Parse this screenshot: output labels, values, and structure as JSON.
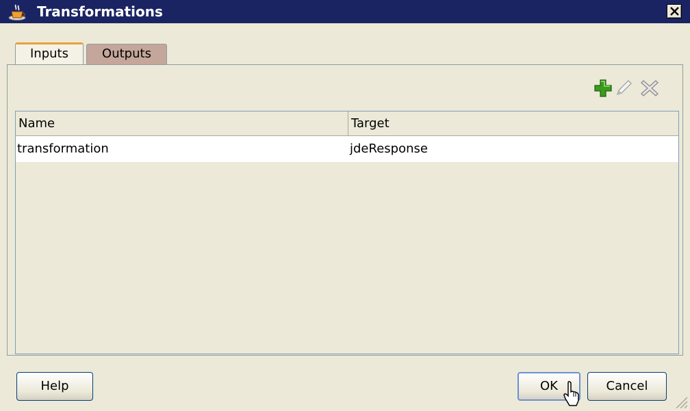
{
  "window": {
    "title": "Transformations",
    "close_icon": "close-icon",
    "app_icon": "coffee-cup-icon"
  },
  "tabs": [
    {
      "label": "Inputs",
      "selected": true
    },
    {
      "label": "Outputs",
      "selected": false
    }
  ],
  "toolbar": {
    "icons": [
      "add-icon",
      "edit-icon",
      "delete-icon"
    ],
    "add_color": "#3a9b1e"
  },
  "table": {
    "columns": [
      "Name",
      "Target"
    ],
    "rows": [
      {
        "name": "transformation",
        "target": "jdeResponse"
      }
    ]
  },
  "buttons": {
    "help": "Help",
    "ok": "OK",
    "cancel": "Cancel"
  },
  "colors": {
    "titlebar": "#1a2463",
    "selected_tab_accent": "#e7a238",
    "unselected_tab": "#c4a69a"
  }
}
